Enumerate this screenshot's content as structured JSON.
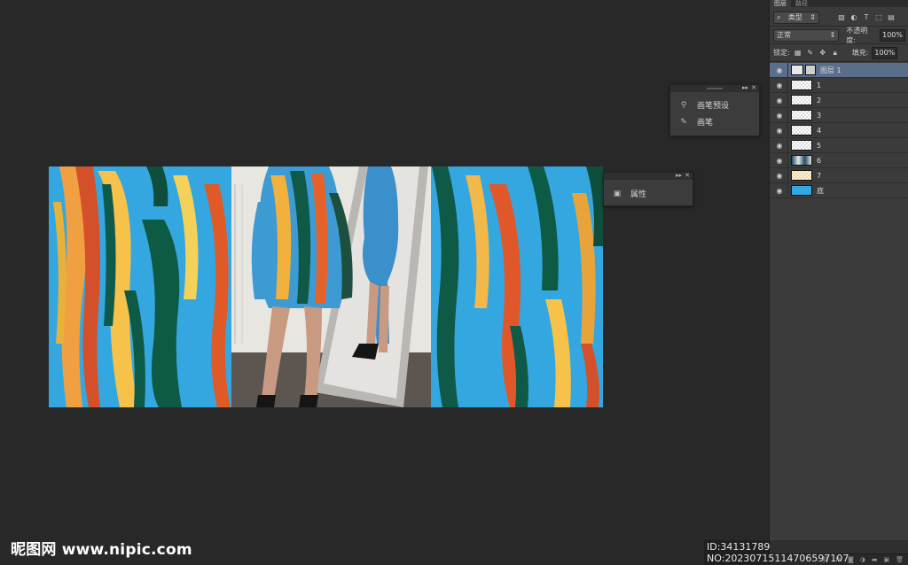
{
  "layers_panel": {
    "tabs": [
      "图层",
      "路径"
    ],
    "filter_kind": "类型",
    "blend_mode": "正常",
    "opacity_label": "不透明度:",
    "opacity_value": "100%",
    "lock_label": "锁定:",
    "fill_label": "填充:",
    "fill_value": "100%",
    "layers": [
      {
        "name": "图层 1",
        "selected": true
      },
      {
        "name": "1"
      },
      {
        "name": "2"
      },
      {
        "name": "3"
      },
      {
        "name": "4"
      },
      {
        "name": "5"
      },
      {
        "name": "6"
      },
      {
        "name": "7"
      },
      {
        "name": "底"
      }
    ],
    "bottom_icons": [
      "link-icon",
      "fx",
      "mask-icon",
      "adjustment-icon",
      "folder-icon",
      "new-layer-icon",
      "trash-icon"
    ]
  },
  "brush_panel": {
    "items": [
      {
        "label": "画笔预设",
        "icon": "brush-presets-icon"
      },
      {
        "label": "画笔",
        "icon": "brush-icon"
      }
    ]
  },
  "properties_panel": {
    "items": [
      {
        "label": "属性",
        "icon": "properties-icon"
      }
    ]
  },
  "watermark": {
    "brand": "昵图网 www.nipic.com",
    "id_text": "ID:34131789 NO:20230715114706597107"
  },
  "colors": {
    "workspace": "#282828",
    "panel": "#3b3b3b",
    "selected_layer": "#5a6e8c",
    "canvas_blue": "#35a7e0"
  }
}
